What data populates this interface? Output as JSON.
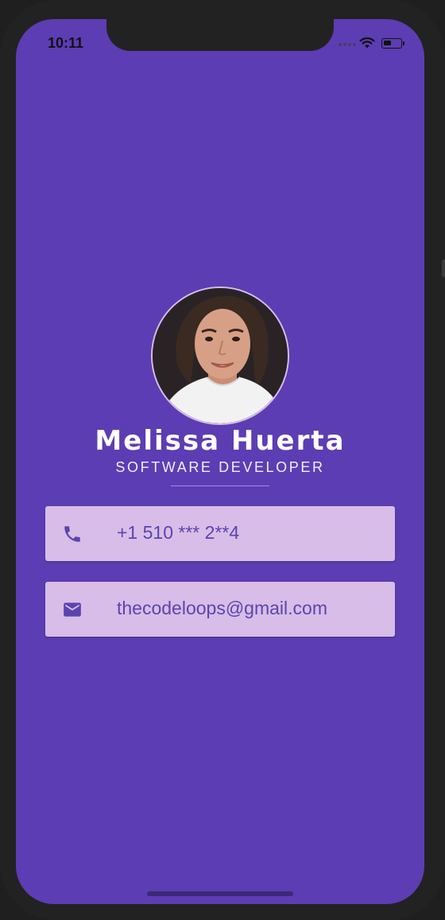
{
  "status_bar": {
    "time": "10:11",
    "battery_level": 0.45,
    "icons": [
      "signal-dots-icon",
      "wifi-icon",
      "battery-icon"
    ]
  },
  "profile": {
    "photo": "profile-photo",
    "name": "Melissa Huerta",
    "job_title": "SOFTWARE DEVELOPER"
  },
  "contacts": [
    {
      "type": "phone",
      "icon": "phone-icon",
      "value": "+1 510 *** 2**4"
    },
    {
      "type": "email",
      "icon": "mail-icon",
      "value": "thecodeloops@gmail.com"
    }
  ],
  "colors": {
    "background": "#5c3db3",
    "card": "#d7bde7",
    "card_text": "#5b45b0",
    "icon": "#5a44b0",
    "device_frame": "#222222"
  }
}
